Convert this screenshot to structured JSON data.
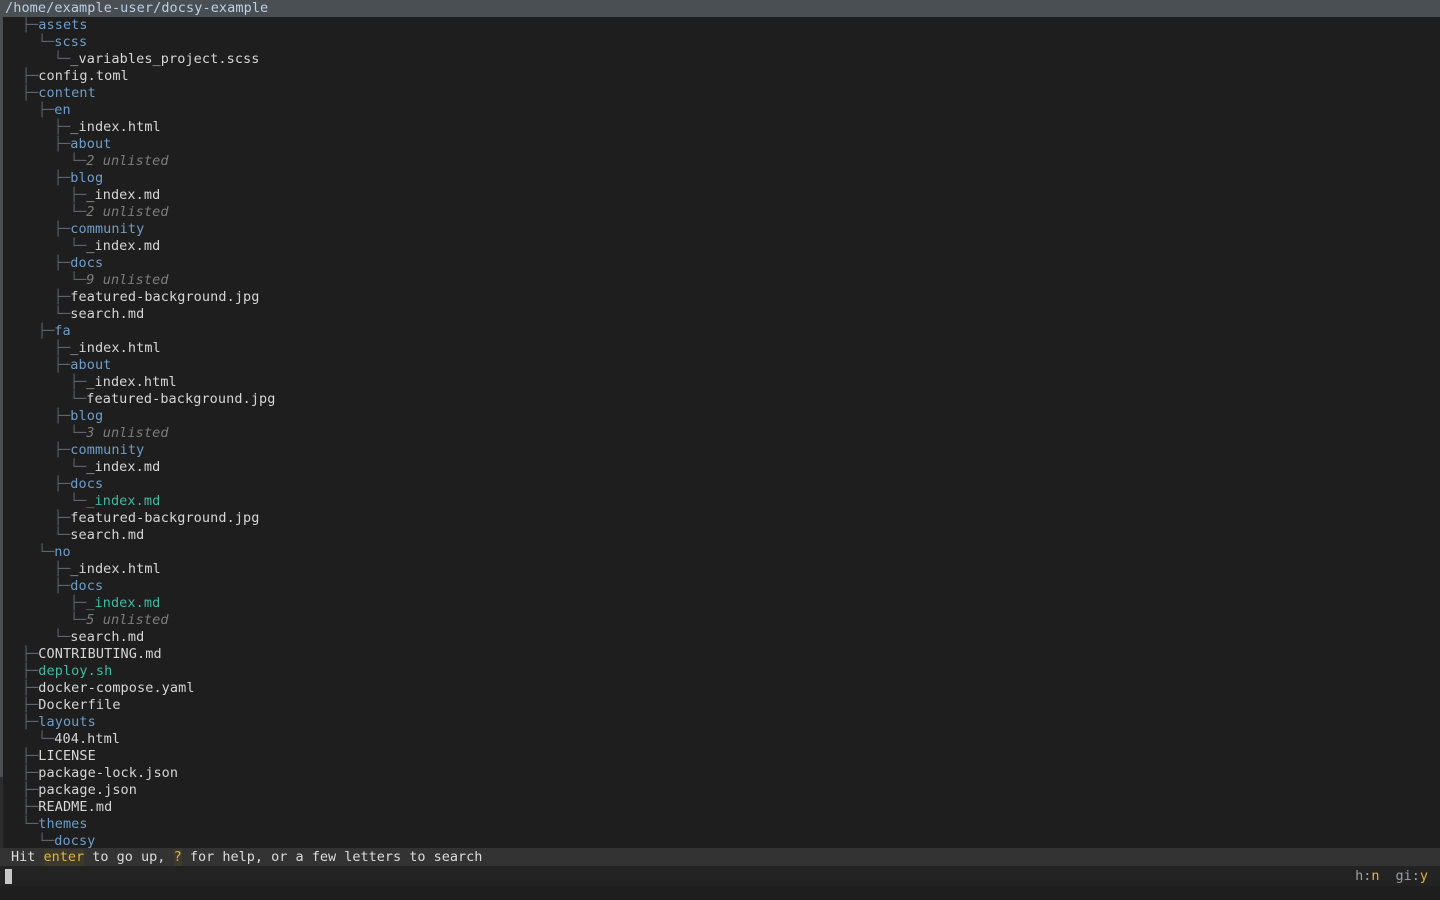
{
  "header": {
    "path": "/home/example-user/docsy-example"
  },
  "tree": {
    "rows": [
      {
        "indent": 0,
        "branch": "├─",
        "name": "assets",
        "kind": "dir"
      },
      {
        "indent": 1,
        "branch": "└─",
        "name": "scss",
        "kind": "dir"
      },
      {
        "indent": 2,
        "branch": "└─",
        "name": "_variables_project.scss",
        "kind": "file"
      },
      {
        "indent": 0,
        "branch": "├─",
        "name": "config.toml",
        "kind": "file"
      },
      {
        "indent": 0,
        "branch": "├─",
        "name": "content",
        "kind": "dir"
      },
      {
        "indent": 1,
        "branch": "├─",
        "name": "en",
        "kind": "dir"
      },
      {
        "indent": 2,
        "branch": "├─",
        "name": "_index.html",
        "kind": "file"
      },
      {
        "indent": 2,
        "branch": "├─",
        "name": "about",
        "kind": "dir"
      },
      {
        "indent": 3,
        "branch": "└─",
        "name": "2 unlisted",
        "kind": "unlisted"
      },
      {
        "indent": 2,
        "branch": "├─",
        "name": "blog",
        "kind": "dir"
      },
      {
        "indent": 3,
        "branch": "├─",
        "name": "_index.md",
        "kind": "file"
      },
      {
        "indent": 3,
        "branch": "└─",
        "name": "2 unlisted",
        "kind": "unlisted"
      },
      {
        "indent": 2,
        "branch": "├─",
        "name": "community",
        "kind": "dir"
      },
      {
        "indent": 3,
        "branch": "└─",
        "name": "_index.md",
        "kind": "file"
      },
      {
        "indent": 2,
        "branch": "├─",
        "name": "docs",
        "kind": "dir"
      },
      {
        "indent": 3,
        "branch": "└─",
        "name": "9 unlisted",
        "kind": "unlisted"
      },
      {
        "indent": 2,
        "branch": "├─",
        "name": "featured-background.jpg",
        "kind": "file"
      },
      {
        "indent": 2,
        "branch": "└─",
        "name": "search.md",
        "kind": "file"
      },
      {
        "indent": 1,
        "branch": "├─",
        "name": "fa",
        "kind": "dir"
      },
      {
        "indent": 2,
        "branch": "├─",
        "name": "_index.html",
        "kind": "file"
      },
      {
        "indent": 2,
        "branch": "├─",
        "name": "about",
        "kind": "dir"
      },
      {
        "indent": 3,
        "branch": "├─",
        "name": "_index.html",
        "kind": "file"
      },
      {
        "indent": 3,
        "branch": "└─",
        "name": "featured-background.jpg",
        "kind": "file"
      },
      {
        "indent": 2,
        "branch": "├─",
        "name": "blog",
        "kind": "dir"
      },
      {
        "indent": 3,
        "branch": "└─",
        "name": "3 unlisted",
        "kind": "unlisted"
      },
      {
        "indent": 2,
        "branch": "├─",
        "name": "community",
        "kind": "dir"
      },
      {
        "indent": 3,
        "branch": "└─",
        "name": "_index.md",
        "kind": "file"
      },
      {
        "indent": 2,
        "branch": "├─",
        "name": "docs",
        "kind": "dir"
      },
      {
        "indent": 3,
        "branch": "└─",
        "name": "_index.md",
        "kind": "exec"
      },
      {
        "indent": 2,
        "branch": "├─",
        "name": "featured-background.jpg",
        "kind": "file"
      },
      {
        "indent": 2,
        "branch": "└─",
        "name": "search.md",
        "kind": "file"
      },
      {
        "indent": 1,
        "branch": "└─",
        "name": "no",
        "kind": "dir"
      },
      {
        "indent": 2,
        "branch": "├─",
        "name": "_index.html",
        "kind": "file"
      },
      {
        "indent": 2,
        "branch": "├─",
        "name": "docs",
        "kind": "dir"
      },
      {
        "indent": 3,
        "branch": "├─",
        "name": "_index.md",
        "kind": "exec"
      },
      {
        "indent": 3,
        "branch": "└─",
        "name": "5 unlisted",
        "kind": "unlisted"
      },
      {
        "indent": 2,
        "branch": "└─",
        "name": "search.md",
        "kind": "file"
      },
      {
        "indent": 0,
        "branch": "├─",
        "name": "CONTRIBUTING.md",
        "kind": "file"
      },
      {
        "indent": 0,
        "branch": "├─",
        "name": "deploy.sh",
        "kind": "exec"
      },
      {
        "indent": 0,
        "branch": "├─",
        "name": "docker-compose.yaml",
        "kind": "file"
      },
      {
        "indent": 0,
        "branch": "├─",
        "name": "Dockerfile",
        "kind": "file"
      },
      {
        "indent": 0,
        "branch": "├─",
        "name": "layouts",
        "kind": "dir"
      },
      {
        "indent": 1,
        "branch": "└─",
        "name": "404.html",
        "kind": "file"
      },
      {
        "indent": 0,
        "branch": "├─",
        "name": "LICENSE",
        "kind": "file"
      },
      {
        "indent": 0,
        "branch": "├─",
        "name": "package-lock.json",
        "kind": "file"
      },
      {
        "indent": 0,
        "branch": "├─",
        "name": "package.json",
        "kind": "file"
      },
      {
        "indent": 0,
        "branch": "├─",
        "name": "README.md",
        "kind": "file"
      },
      {
        "indent": 0,
        "branch": "└─",
        "name": "themes",
        "kind": "dir"
      },
      {
        "indent": 1,
        "branch": "└─",
        "name": "docsy",
        "kind": "dir"
      }
    ]
  },
  "status": {
    "help_prefix": "Hit ",
    "help_key_enter": "enter",
    "help_mid": " to go up, ",
    "help_key_question": "?",
    "help_suffix": " for help, or a few letters to search"
  },
  "input": {
    "value": ""
  },
  "flags": [
    {
      "key": "h:",
      "value": "n"
    },
    {
      "key": "gi:",
      "value": "y"
    }
  ],
  "colors": {
    "background": "#1e1e1e",
    "path_bar": "#4a4f54",
    "directory": "#6d9ecb",
    "file": "#d6d6d6",
    "executable": "#3fbba4",
    "unlisted": "#7d7d7d",
    "branch": "#5e6570",
    "highlight": "#e3b341"
  }
}
